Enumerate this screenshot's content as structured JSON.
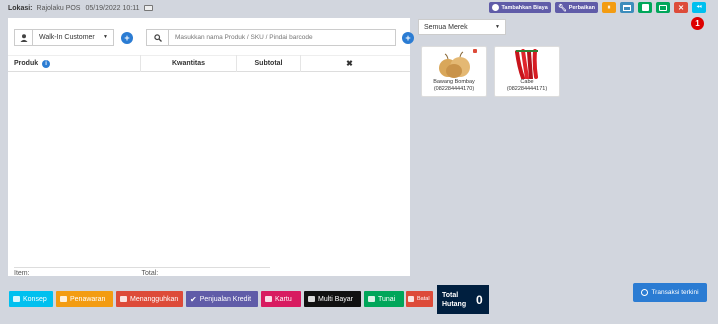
{
  "topbar": {
    "location_label": "Lokasi:",
    "location_name": "Rajolaku POS",
    "date": "05/19/2022 10:11",
    "add_cost_label": "Tambahkan Biaya",
    "repair_label": "Perbaikan",
    "notification_badge": "1"
  },
  "customer": {
    "selected": "Walk-In Customer"
  },
  "search": {
    "placeholder": "Masukkan nama Produk / SKU / Pindai barcode"
  },
  "cart": {
    "columns": {
      "product": "Produk",
      "quantity": "Kwantitas",
      "subtotal": "Subtotal",
      "remove": "✖"
    },
    "footer": {
      "items": "Item: 0",
      "total": "Total: 0"
    }
  },
  "brand_filter": {
    "selected": "Semua Merek"
  },
  "products": [
    {
      "name": "Bawang Bombay",
      "sku": "(082284444170)"
    },
    {
      "name": "Cabe",
      "sku": "(082284444171)"
    }
  ],
  "bottom": {
    "konsep": "Konsep",
    "penawaran": "Penawaran",
    "menangguhkan": "Menangguhkan",
    "penjualan_kredit": "Penjualan Kredit",
    "kartu": "Kartu",
    "multi_bayar": "Multi Bayar",
    "tunai": "Tunai",
    "batal": "Batal",
    "total_label": "Total Hutang",
    "total_value": "0",
    "recent": "Transaksi terkini"
  },
  "colors": {
    "background": "#d2d6de",
    "primary": "#2b7cd3",
    "total_box": "#001f3f"
  }
}
